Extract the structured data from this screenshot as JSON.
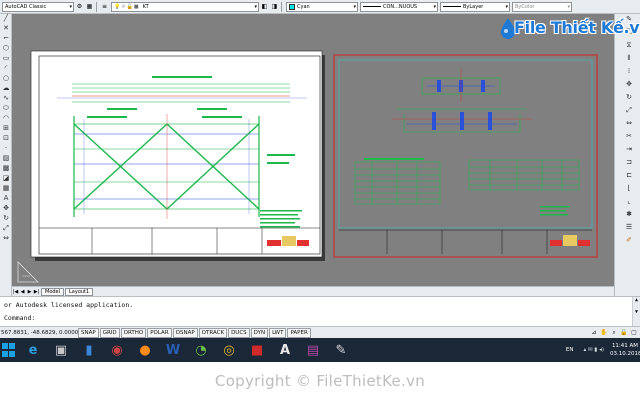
{
  "toolbar": {
    "workspace": "AutoCAD Classic",
    "layer": "KT",
    "color": "Cyan",
    "linetype": "CON...NUOUS",
    "lineweight": "ByLayer",
    "plotstyle": "ByColor"
  },
  "layout_tabs": [
    {
      "label": "Model"
    },
    {
      "label": "Layout1"
    }
  ],
  "command": {
    "history": "or Autodesk licensed application.",
    "prompt": "Command:"
  },
  "status": {
    "coords": "567.8831, -48.6829, 0.0000",
    "toggles": [
      "SNAP",
      "GRID",
      "ORTHO",
      "POLAR",
      "OSNAP",
      "OTRACK",
      "DUCS",
      "DYN",
      "LWT",
      "PAPER"
    ]
  },
  "taskbar": {
    "apps": [
      {
        "icon": "windows-start-icon"
      },
      {
        "icon": "internet-explorer-icon",
        "glyph": "e",
        "color": "#2d9cdb"
      },
      {
        "icon": "network-drive-icon",
        "glyph": "▣",
        "color": "#c8c8c8"
      },
      {
        "icon": "onedrive-icon",
        "glyph": "▮",
        "color": "#3a87d8"
      },
      {
        "icon": "media-icon",
        "glyph": "◉",
        "color": "#c44"
      },
      {
        "icon": "firefox-icon",
        "glyph": "●",
        "color": "#ff8c1a"
      },
      {
        "icon": "word-icon",
        "glyph": "W",
        "color": "#2b5fb5"
      },
      {
        "icon": "cad-viewer-icon",
        "glyph": "◔",
        "color": "#6bc04b"
      },
      {
        "icon": "chrome-icon",
        "glyph": "◎",
        "color": "#e7b52c"
      },
      {
        "icon": "recorder-icon",
        "glyph": "■",
        "color": "#d12a2a"
      },
      {
        "icon": "autocad-icon",
        "glyph": "A",
        "color": "#e8e8e8"
      },
      {
        "icon": "rar-icon",
        "glyph": "▤",
        "color": "#b44ba6"
      },
      {
        "icon": "paint-icon",
        "glyph": "✎",
        "color": "#d9d9d9"
      }
    ],
    "language": "EN",
    "time": "11:41 AM",
    "date": "03.10.2018"
  },
  "branding": {
    "logo": "File Thiết Kế.vn",
    "copyright": "Copyright © FileThietKe.vn"
  },
  "colors": {
    "canvas": "#808080",
    "sheet_left": "#ffffff",
    "sheet_right_border": "#d62020",
    "drawing_green": "#1bb84a",
    "drawing_red": "#e03030",
    "drawing_blue": "#2a4fd8",
    "taskbar": "#1a2838",
    "logo": "#1f7ad6"
  }
}
